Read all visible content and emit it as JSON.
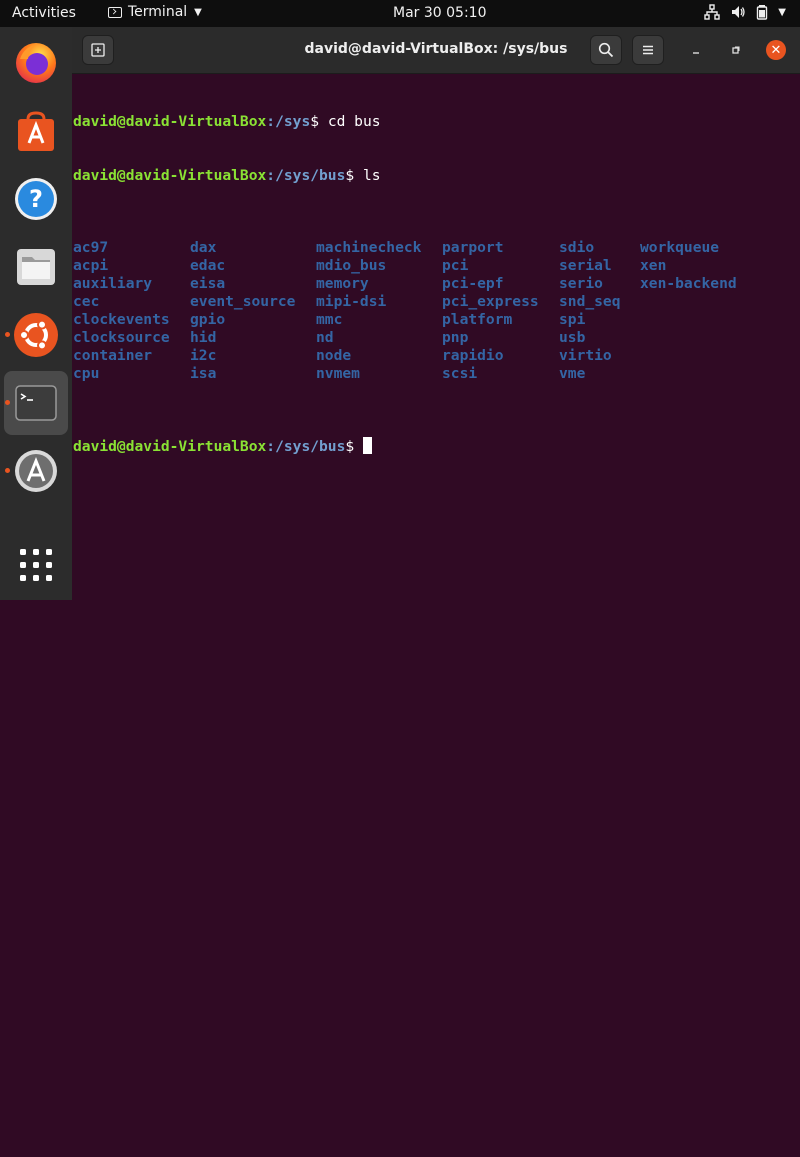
{
  "topbar": {
    "activities": "Activities",
    "app_name": "Terminal",
    "clock": "Mar 30  05:10"
  },
  "window": {
    "title": "david@david-VirtualBox: /sys/bus"
  },
  "terminal": {
    "prompt_user_host": "david@david-VirtualBox",
    "lines": [
      {
        "path": ":/sys",
        "cmd": " cd bus"
      },
      {
        "path": ":/sys/bus",
        "cmd": " ls"
      }
    ],
    "ls_columns": [
      [
        "ac97",
        "acpi",
        "auxiliary",
        "cec",
        "clockevents",
        "clocksource",
        "container",
        "cpu"
      ],
      [
        "dax",
        "edac",
        "eisa",
        "event_source",
        "gpio",
        "hid",
        "i2c",
        "isa"
      ],
      [
        "machinecheck",
        "mdio_bus",
        "memory",
        "mipi-dsi",
        "mmc",
        "nd",
        "node",
        "nvmem"
      ],
      [
        "parport",
        "pci",
        "pci-epf",
        "pci_express",
        "platform",
        "pnp",
        "rapidio",
        "scsi"
      ],
      [
        "sdio",
        "serial",
        "serio",
        "snd_seq",
        "spi",
        "usb",
        "virtio",
        "vme"
      ],
      [
        "workqueue",
        "xen",
        "xen-backend"
      ]
    ],
    "final_path": ":/sys/bus",
    "dollar": "$"
  },
  "dock": {
    "items": [
      {
        "name": "firefox-icon",
        "running": false
      },
      {
        "name": "software-store-icon",
        "running": false
      },
      {
        "name": "help-icon",
        "running": false
      },
      {
        "name": "files-icon",
        "running": false
      },
      {
        "name": "ubuntu-icon",
        "running": true
      },
      {
        "name": "terminal-icon",
        "running": true,
        "active": true
      },
      {
        "name": "software-updater-icon",
        "running": true
      },
      {
        "name": "show-apps-icon",
        "running": false
      }
    ]
  },
  "colors": {
    "terminal_bg": "#300a24",
    "prompt_green": "#8ae234",
    "prompt_blue": "#729fcf",
    "dir_blue": "#3465a4",
    "accent": "#e95420"
  }
}
